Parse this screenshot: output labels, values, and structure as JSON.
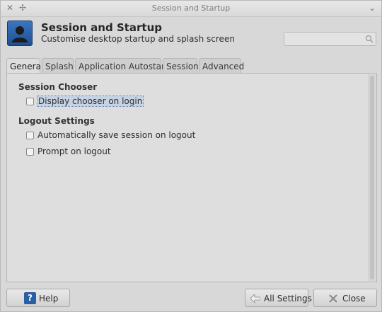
{
  "window": {
    "title": "Session and Startup"
  },
  "header": {
    "title": "Session and Startup",
    "subtitle": "Customise desktop startup and splash screen",
    "search_value": ""
  },
  "tabs": [
    {
      "label": "General",
      "active": true
    },
    {
      "label": "Splash"
    },
    {
      "label": "Application Autostart"
    },
    {
      "label": "Session"
    },
    {
      "label": "Advanced"
    }
  ],
  "general": {
    "session_chooser_title": "Session Chooser",
    "display_chooser_label": "Display chooser on login",
    "display_chooser_checked": false,
    "logout_title": "Logout Settings",
    "auto_save_label": "Automatically save session on logout",
    "auto_save_checked": false,
    "prompt_logout_label": "Prompt on logout",
    "prompt_logout_checked": false
  },
  "footer": {
    "help_label": "Help",
    "all_settings_label": "All Settings",
    "close_label": "Close"
  }
}
